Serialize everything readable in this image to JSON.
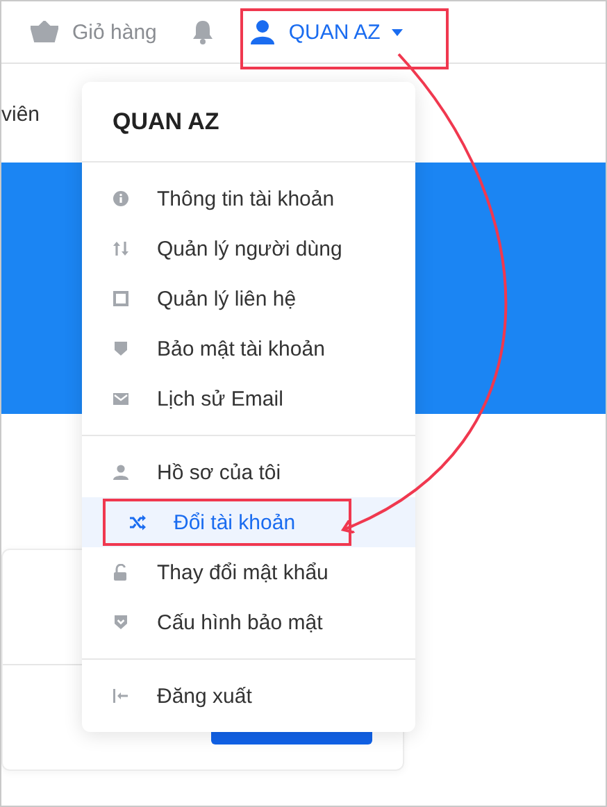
{
  "topbar": {
    "cart_label": "Giỏ hàng",
    "user_name": "QUAN AZ"
  },
  "page": {
    "partial_text": "viên"
  },
  "user_menu": {
    "title": "QUAN AZ",
    "groups": [
      [
        {
          "label": "Thông tin tài khoản",
          "kind": "info",
          "selected": false
        },
        {
          "label": "Quản lý người dùng",
          "kind": "sort",
          "selected": false
        },
        {
          "label": "Quản lý liên hệ",
          "kind": "square",
          "selected": false
        },
        {
          "label": "Bảo mật tài khoản",
          "kind": "shield",
          "selected": false
        },
        {
          "label": "Lịch sử Email",
          "kind": "mail",
          "selected": false
        }
      ],
      [
        {
          "label": "Hồ sơ của tôi",
          "kind": "person",
          "selected": false
        },
        {
          "label": "Đổi tài khoản",
          "kind": "shuffle",
          "selected": true
        },
        {
          "label": "Thay đổi mật khẩu",
          "kind": "unlock",
          "selected": false
        },
        {
          "label": "Cấu hình bảo mật",
          "kind": "shield-check",
          "selected": false
        }
      ],
      [
        {
          "label": "Đăng xuất",
          "kind": "logout",
          "selected": false
        }
      ]
    ]
  }
}
